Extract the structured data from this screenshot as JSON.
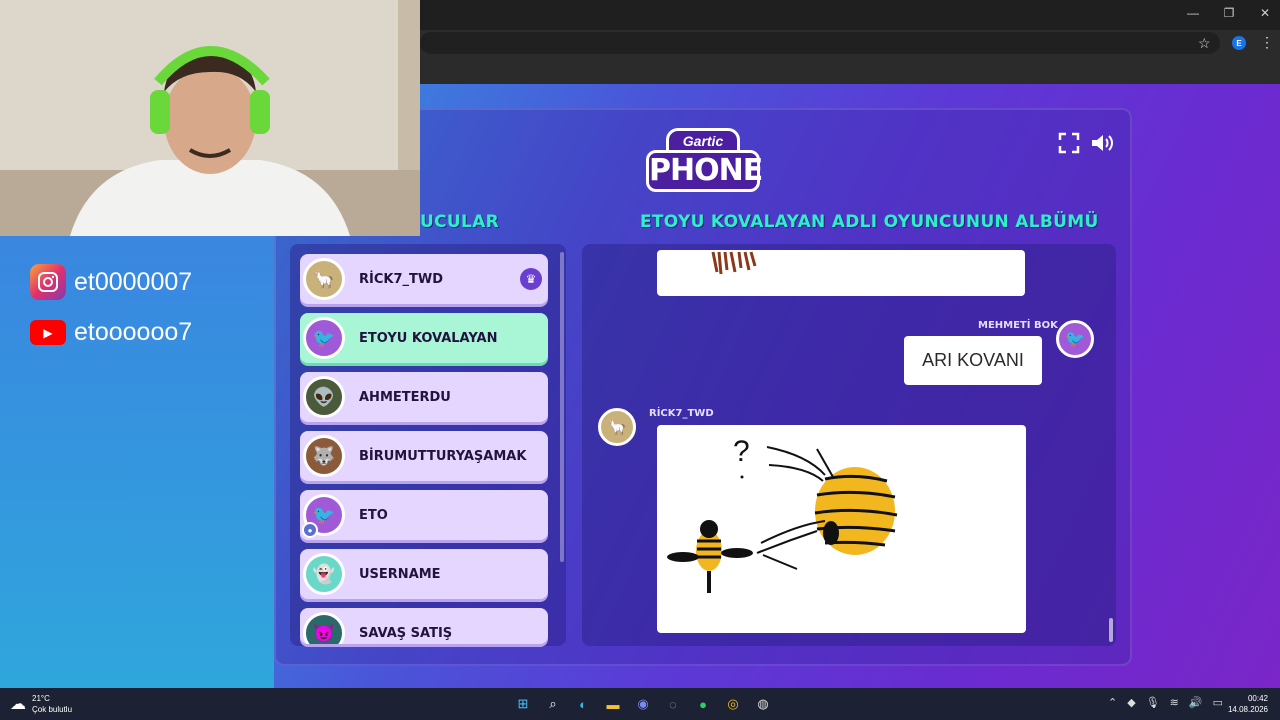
{
  "browser": {
    "window_controls": [
      "—",
      "❐",
      "✕"
    ],
    "profile_initial": "E"
  },
  "game": {
    "logo_top": "Gartic",
    "logo_main": "PHONE",
    "players_title": "UCULAR",
    "album_title": "ETOYU KOVALAYAN ADLI OYUNCUNUN ALBÜMÜ",
    "players": [
      {
        "name": "RİCK7_TWD",
        "avatar_color": "#c8b27a",
        "host": true
      },
      {
        "name": "ETOYU KOVALAYAN",
        "avatar_color": "#a05ad8",
        "active": true
      },
      {
        "name": "AHMETERDU",
        "avatar_color": "#4a5a3a"
      },
      {
        "name": "BİRUMUTTURYAŞAMAK",
        "avatar_color": "#8a5a3a"
      },
      {
        "name": "ETO",
        "avatar_color": "#a05ad8",
        "you": true
      },
      {
        "name": "USERNAME",
        "avatar_color": "#6ad8c8"
      },
      {
        "name": "SAVAŞ SATIŞ",
        "avatar_color": "#2a6a6a"
      }
    ],
    "album": {
      "guess_author": "MEHMETİ BOK",
      "guess_text": "ARI KOVANI",
      "drawing_author": "RİCK7_TWD"
    }
  },
  "overlay": {
    "instagram": "et0000007",
    "youtube": "etoooooo7"
  },
  "taskbar": {
    "temperature": "21°C",
    "weather": "Çok bulutlu",
    "time": "00:42",
    "date": "14.08.2026"
  }
}
